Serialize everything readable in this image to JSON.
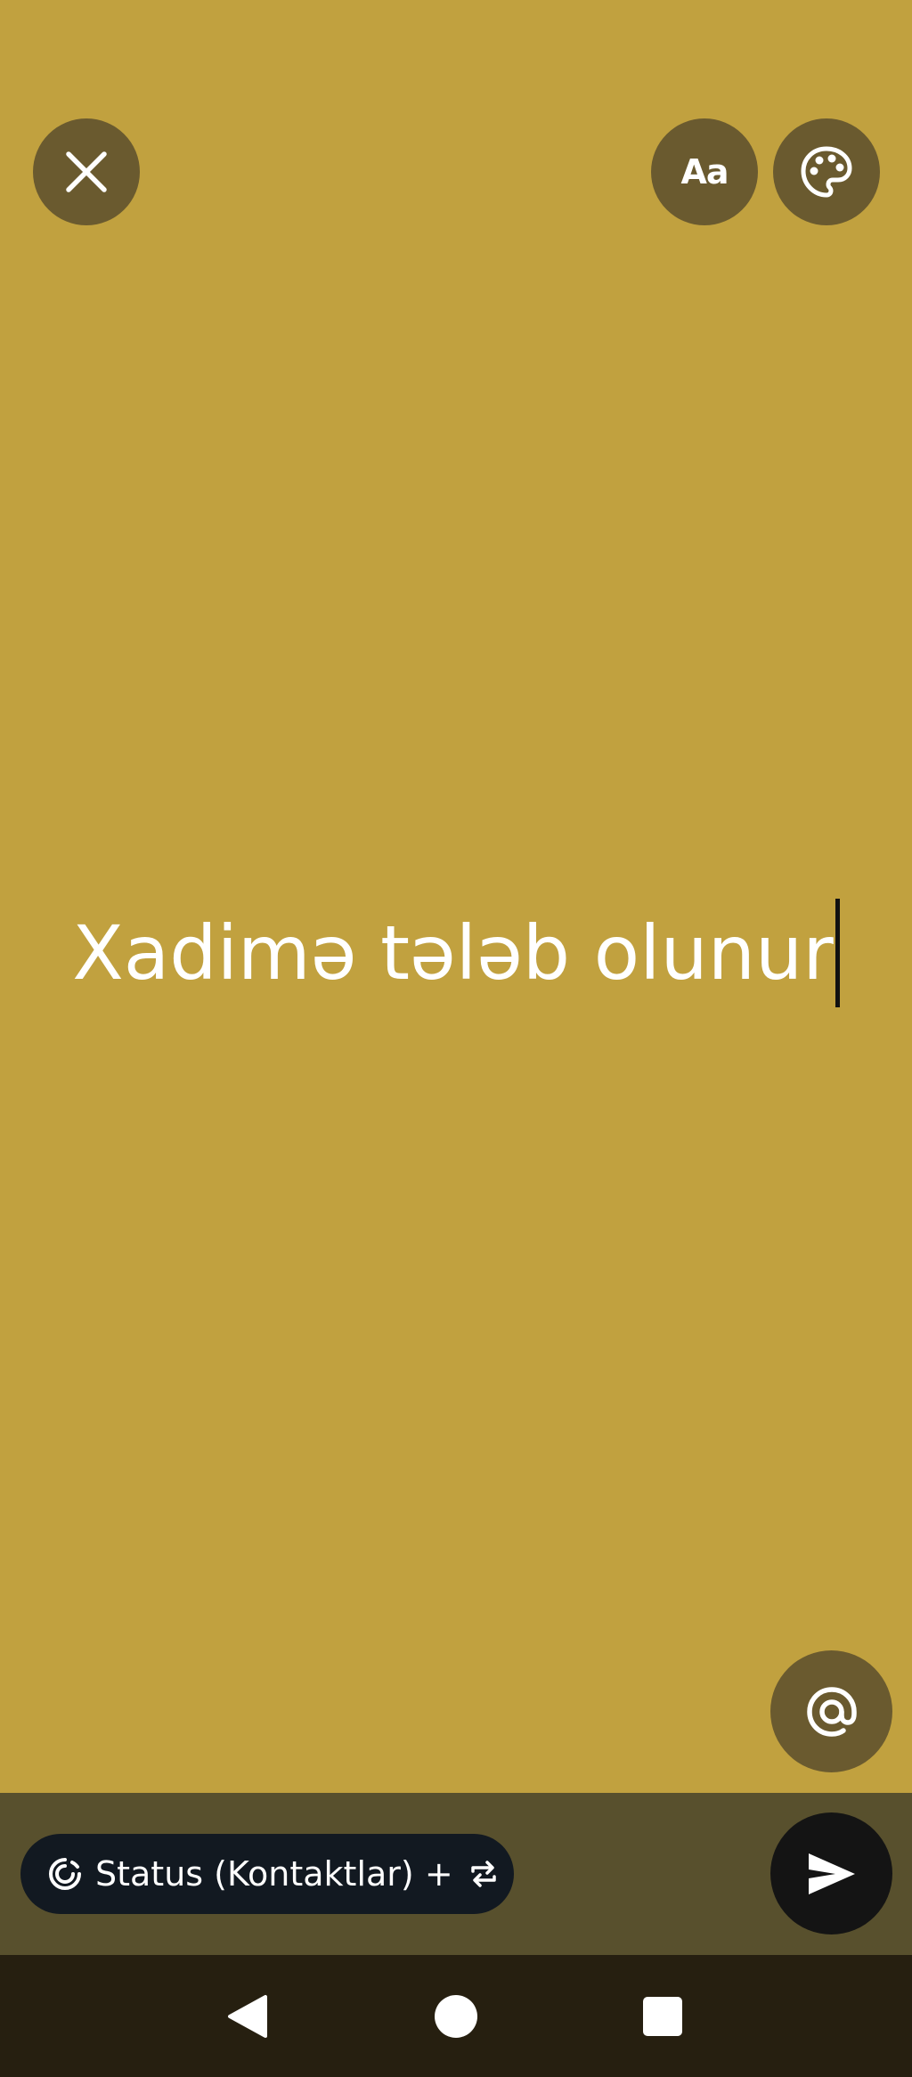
{
  "header": {
    "close_icon": "close-icon",
    "font_button_label": "Aa",
    "palette_icon": "palette-icon"
  },
  "editor": {
    "status_text": "Xadimə tələb olunur"
  },
  "mention_icon": "at-icon",
  "audience": {
    "label": "Status (Kontaktlar) +",
    "status_icon": "status-ring-icon",
    "repeat_icon": "repeat-icon"
  },
  "send_icon": "send-icon",
  "nav": {
    "back_icon": "back-icon",
    "home_icon": "home-icon",
    "recents_icon": "recents-icon"
  },
  "colors": {
    "background": "#c1a13f",
    "button_bg": "#6a5a2f",
    "bottom_bar": "#58502d",
    "chip_bg": "#121921",
    "send_bg": "#141414",
    "nav_bg": "#261f10",
    "text": "#ffffff"
  }
}
